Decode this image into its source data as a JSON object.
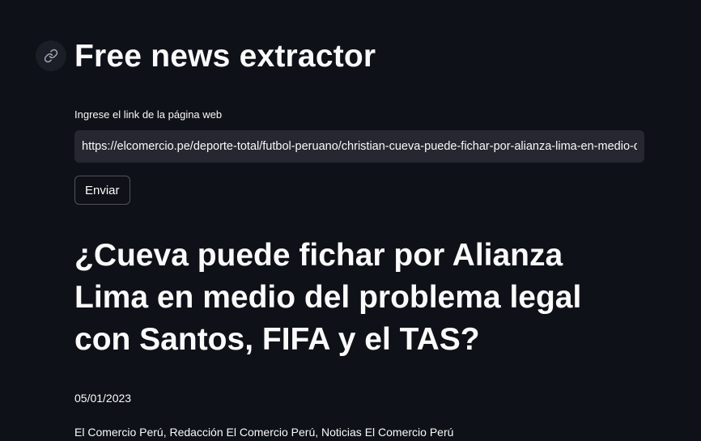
{
  "app": {
    "title": "Free news extractor",
    "anchor_icon": "link-icon"
  },
  "form": {
    "url_label": "Ingrese el link de la página web",
    "url_value": "https://elcomercio.pe/deporte-total/futbol-peruano/christian-cueva-puede-fichar-por-alianza-lima-en-medio-del-problema-legal-con-santos-fifa-y-el-tas-noticia/",
    "submit_label": "Enviar"
  },
  "article": {
    "headline": "¿Cueva puede fichar por Alianza Lima en medio del problema legal con Santos, FIFA y el TAS?",
    "date": "05/01/2023",
    "authors": "El Comercio Perú, Redacción El Comercio Perú, Noticias El Comercio Perú"
  },
  "colors": {
    "background": "#0e1117",
    "input_background": "#262730",
    "text": "#fafafa"
  }
}
